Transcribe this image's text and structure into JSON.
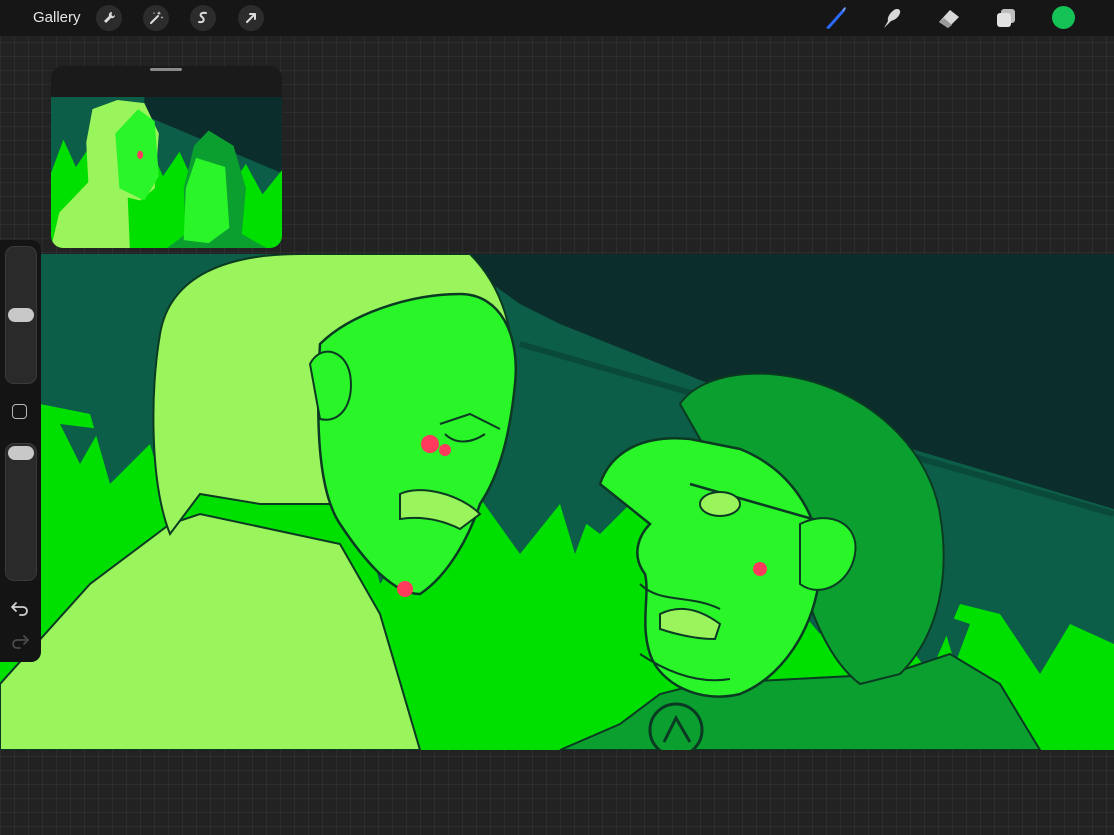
{
  "toolbar": {
    "gallery_label": "Gallery",
    "left_tools": [
      "wrench-icon",
      "magic-wand-icon",
      "selection-icon",
      "transform-arrow-icon"
    ],
    "right_tools": [
      "brush-icon",
      "smudge-icon",
      "eraser-icon",
      "layers-icon"
    ],
    "active_tool": "brush-icon",
    "current_color": "#14c256",
    "accent_color": "#2b6bff"
  },
  "sidebar": {
    "brush_size_level": 0.5,
    "opacity_level": 1.0,
    "items": [
      "brush-size-slider",
      "modify-button",
      "opacity-slider",
      "undo-icon",
      "redo-icon"
    ]
  },
  "reference_panel": {
    "visible": true
  },
  "canvas": {
    "palette": [
      "#0b2d2b",
      "#0d5e48",
      "#00e000",
      "#29f529",
      "#9af55c",
      "#0a9f2f",
      "#ff3a5c"
    ]
  }
}
